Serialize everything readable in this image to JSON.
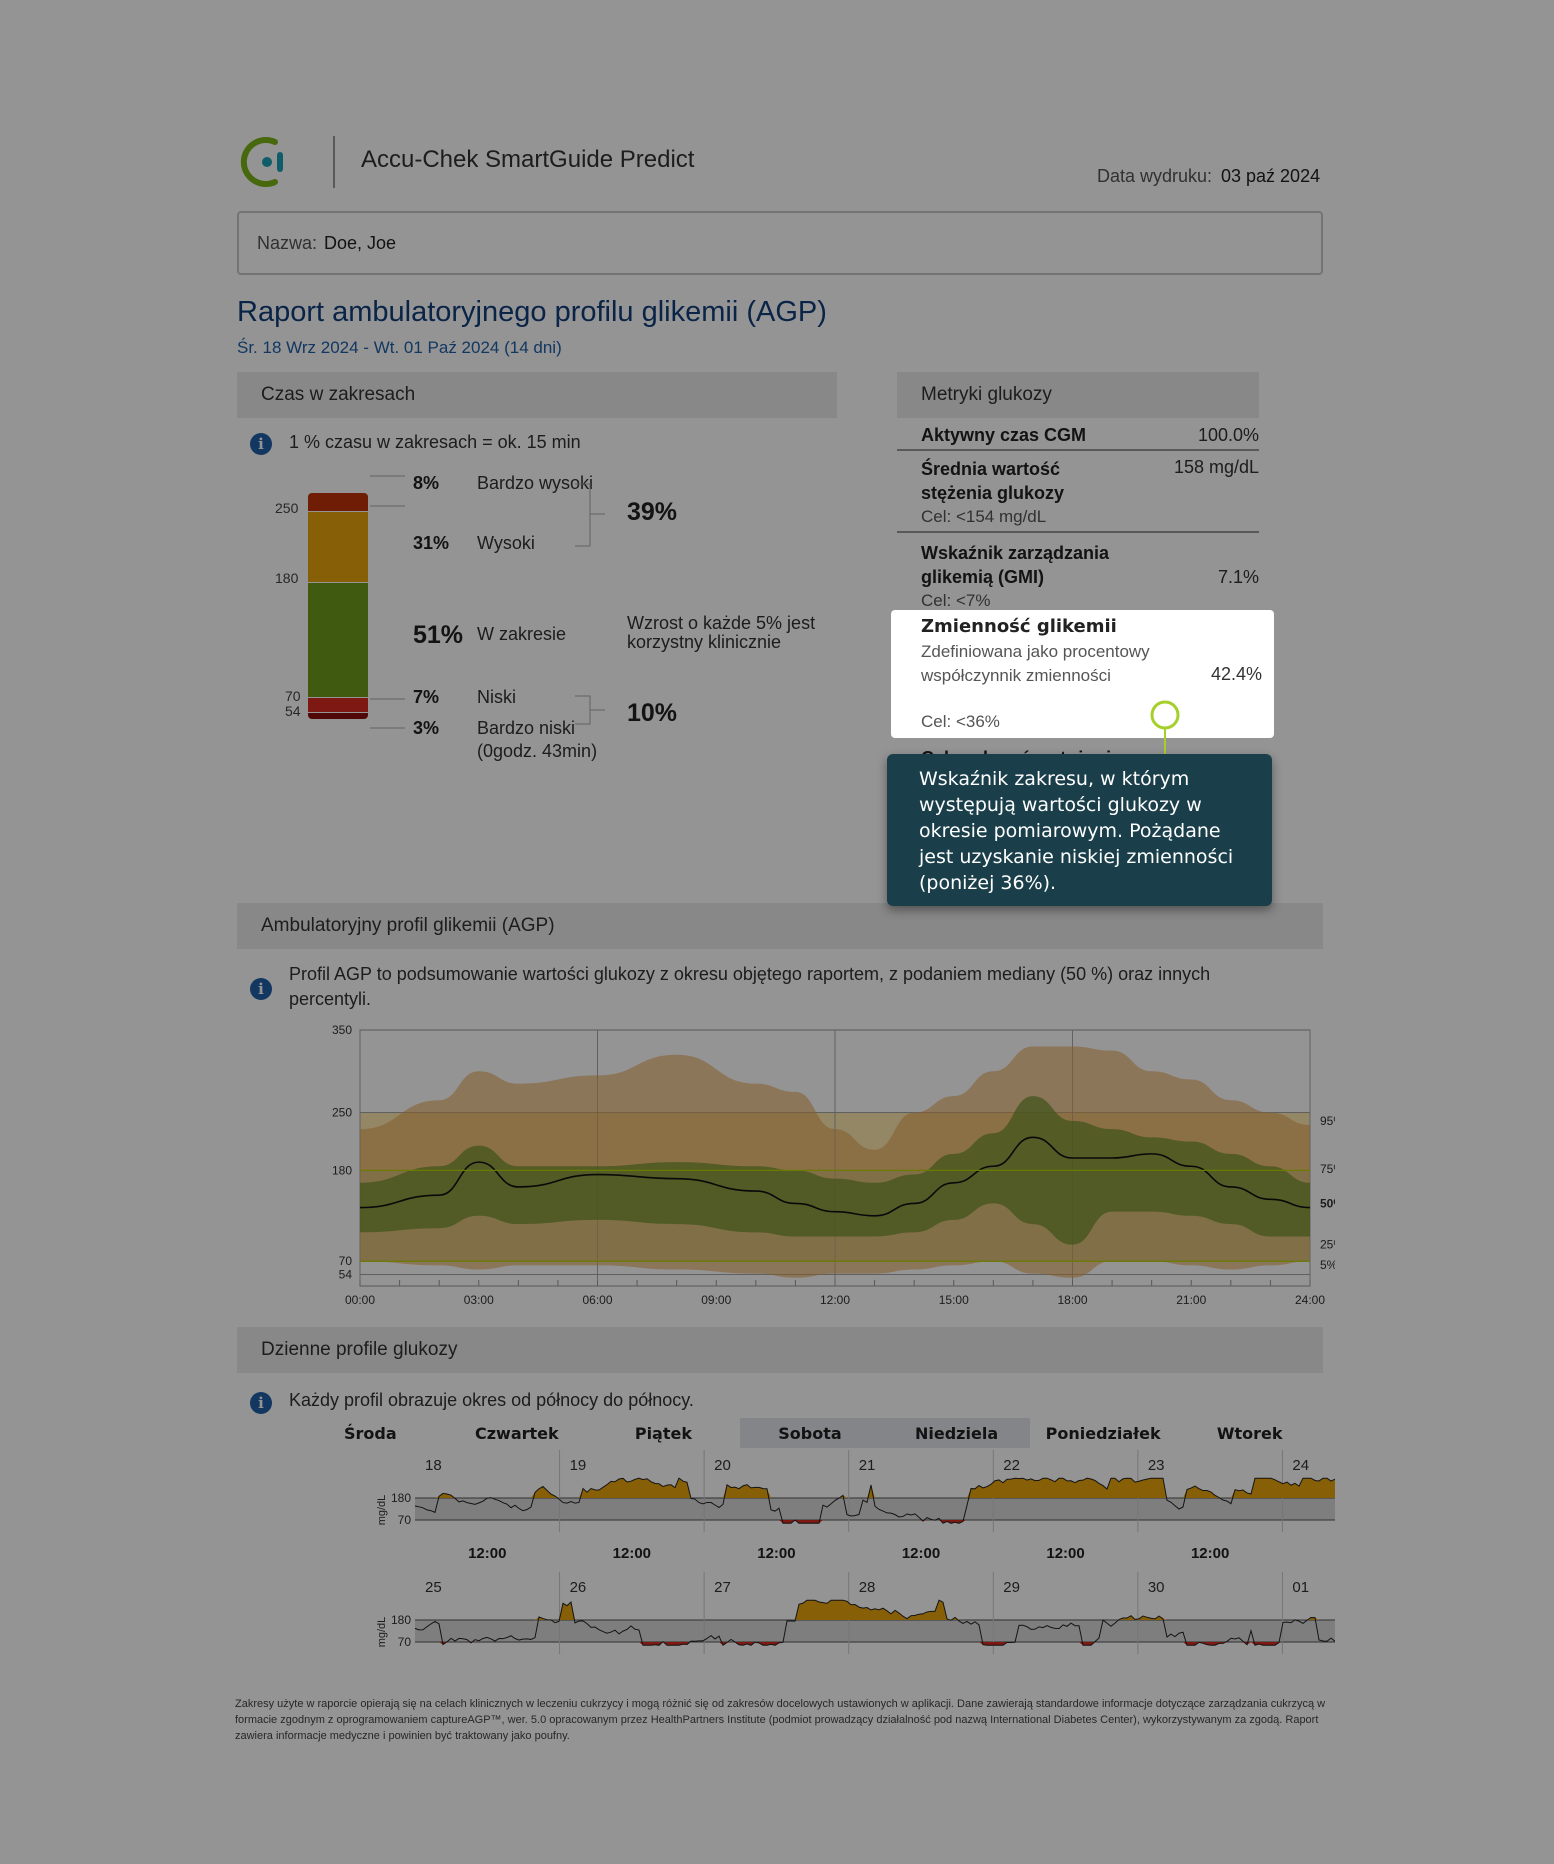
{
  "header": {
    "app_name": "Accu-Chek SmartGuide Predict",
    "print_label": "Data wydruku:",
    "print_date": "03 paź 2024"
  },
  "patient": {
    "name_label": "Nazwa:",
    "name": "Doe, Joe"
  },
  "report": {
    "title": "Raport ambulatoryjnego profilu glikemii (AGP)",
    "range": "Śr. 18 Wrz 2024 - Wt. 01 Paź 2024 (14 dni)"
  },
  "time_in_range": {
    "heading": "Czas w zakresach",
    "info": "1 % czasu w zakresach = ok. 15 min",
    "thresholds": [
      "250",
      "180",
      "70",
      "54"
    ],
    "rows": [
      {
        "pct": "8%",
        "label": "Bardzo wysoki",
        "value": 8,
        "color": "#c0350a"
      },
      {
        "pct": "31%",
        "label": "Wysoki",
        "value": 31,
        "color": "#e8a40c"
      },
      {
        "pct": "51%",
        "label": "W zakresie",
        "value": 51,
        "color": "#6e9b1c"
      },
      {
        "pct": "7%",
        "label": "Niski",
        "value": 7,
        "color": "#d72a1f"
      },
      {
        "pct": "3%",
        "label": "Bardzo niski",
        "value": 3,
        "color": "#8a0d0d"
      }
    ],
    "very_low_duration": "(0godz. 43min)",
    "high_total": "39%",
    "low_total": "10%",
    "in_range_note": "Wzrost o każde 5% jest korzystny klinicznie"
  },
  "metrics": {
    "heading": "Metryki glukozy",
    "cgm_label": "Aktywny czas CGM",
    "cgm_value": "100.0%",
    "mean_label": "Średnia wartość stężenia glukozy",
    "mean_value": "158 mg/dL",
    "mean_target": "Cel: <154 mg/dL",
    "gmi_label": "Wskaźnik zarządzania glikemią (GMI)",
    "gmi_value": "7.1%",
    "gmi_target": "Cel: <7%",
    "cv_label": "Zmienność glikemii",
    "cv_desc": "Zdefiniowana jako procentowy współczynnik zmienności",
    "cv_value": "42.4%",
    "cv_target": "Cel: <36%",
    "next_label_partial": "Cele zakresów stężenia"
  },
  "tooltip": {
    "text": "Wskaźnik zakresu, w którym występują wartości glukozy w okresie pomiarowym. Pożądane jest uzyskanie niskiej zmienności (poniżej 36%)."
  },
  "agp": {
    "heading": "Ambulatoryjny profil glikemii (AGP)",
    "info": "Profil AGP to podsumowanie wartości glukozy z okresu objętego raportem, z podaniem mediany (50 %) oraz innych percentyli.",
    "y_ticks": [
      "350",
      "250",
      "180",
      "70",
      "54"
    ],
    "x_ticks": [
      "00:00",
      "03:00",
      "06:00",
      "09:00",
      "12:00",
      "15:00",
      "18:00",
      "21:00",
      "24:00"
    ],
    "percentile_labels": [
      "95%",
      "75%",
      "50%",
      "25%",
      "5%"
    ]
  },
  "chart_data": {
    "type": "area",
    "title": "Ambulatoryjny profil glikemii (AGP)",
    "x": [
      0,
      2,
      3,
      4,
      6,
      8,
      10,
      11,
      12,
      13,
      14,
      15,
      16,
      17,
      18,
      19,
      20,
      21,
      22,
      23,
      24
    ],
    "ylim": [
      40,
      350
    ],
    "series": [
      {
        "name": "95%",
        "values": [
          230,
          265,
          300,
          285,
          295,
          320,
          285,
          275,
          230,
          205,
          250,
          270,
          300,
          330,
          330,
          325,
          300,
          290,
          265,
          250,
          235
        ]
      },
      {
        "name": "75%",
        "values": [
          165,
          185,
          210,
          185,
          185,
          190,
          185,
          180,
          170,
          165,
          175,
          200,
          225,
          270,
          240,
          230,
          220,
          215,
          200,
          185,
          165
        ]
      },
      {
        "name": "50%",
        "values": [
          135,
          150,
          190,
          160,
          175,
          170,
          155,
          140,
          130,
          125,
          140,
          165,
          185,
          220,
          195,
          195,
          200,
          185,
          160,
          145,
          135
        ]
      },
      {
        "name": "25%",
        "values": [
          105,
          110,
          125,
          115,
          120,
          115,
          105,
          100,
          100,
          100,
          105,
          120,
          140,
          115,
          90,
          130,
          130,
          125,
          115,
          100,
          100
        ]
      },
      {
        "name": "5%",
        "values": [
          70,
          65,
          60,
          65,
          65,
          60,
          55,
          50,
          55,
          55,
          60,
          65,
          70,
          55,
          50,
          70,
          70,
          65,
          60,
          65,
          70
        ]
      }
    ]
  },
  "daily": {
    "heading": "Dzienne profile glukozy",
    "info": "Każdy profil obrazuje okres od północy do północy.",
    "weekdays": [
      "Środa",
      "Czwartek",
      "Piątek",
      "Sobota",
      "Niedziela",
      "Poniedziałek",
      "Wtorek"
    ],
    "week1_dates": [
      "18",
      "19",
      "20",
      "21",
      "22",
      "23",
      "24"
    ],
    "week2_dates": [
      "25",
      "26",
      "27",
      "28",
      "29",
      "30",
      "01"
    ],
    "y_unit": "mg/dL",
    "y_ticks": [
      "180",
      "70"
    ],
    "noon_label": "12:00"
  },
  "footer": {
    "text": "Zakresy użyte w raporcie opierają się na celach klinicznych w leczeniu cukrzycy i mogą różnić się od zakresów docelowych ustawionych w aplikacji. Dane zawierają standardowe informacje dotyczące zarządzania cukrzycą w formacie zgodnym z oprogramowaniem captureAGP™, wer. 5.0 opracowanym przez HealthPartners Institute (podmiot prowadzący działalność pod nazwą International Diabetes Center), wykorzystywanym za zgodą. Raport zawiera informacje medyczne i powinien być traktowany jako poufny."
  }
}
